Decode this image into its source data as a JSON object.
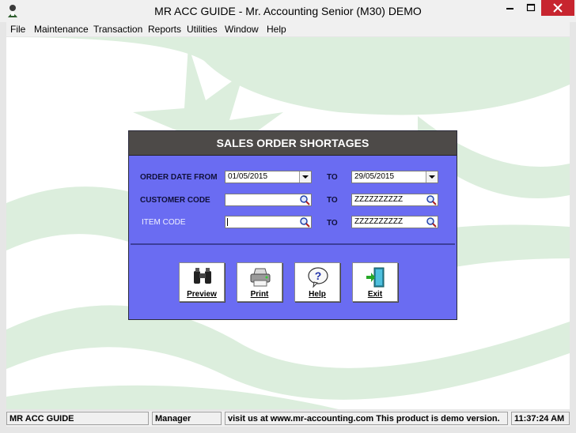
{
  "window": {
    "title": "MR ACC GUIDE - Mr. Accounting Senior (M30) DEMO"
  },
  "menu": {
    "items": [
      "File",
      "Maintenance",
      "Transaction",
      "Reports",
      "Utilities",
      "Window",
      "Help"
    ]
  },
  "dialog": {
    "title": "SALES ORDER SHORTAGES",
    "to_label": "TO",
    "order_date": {
      "label": "ORDER DATE FROM",
      "from": "01/05/2015",
      "to": "29/05/2015"
    },
    "customer": {
      "label": "CUSTOMER CODE",
      "from": "",
      "to": "ZZZZZZZZZZ"
    },
    "item": {
      "label": "ITEM CODE",
      "from": "",
      "to": "ZZZZZZZZZZ"
    },
    "buttons": {
      "preview": "Preview",
      "print": "Print",
      "help": "Help",
      "exit": "Exit"
    }
  },
  "status": {
    "app": "MR ACC GUIDE",
    "user": "Manager",
    "message": "visit us at www.mr-accounting.com This product is demo version.",
    "time": "11:37:24 AM"
  },
  "colors": {
    "dialog_bg": "#6a6cf2",
    "dialog_header": "#4d4a48",
    "watermark": "#dceedd",
    "close_button": "#c7252f"
  },
  "icons": [
    "app-person-icon",
    "minimize-icon",
    "maximize-icon",
    "close-icon",
    "dropdown-arrow-icon",
    "magnifier-icon",
    "binoculars-icon",
    "printer-icon",
    "help-question-icon",
    "exit-door-icon"
  ]
}
